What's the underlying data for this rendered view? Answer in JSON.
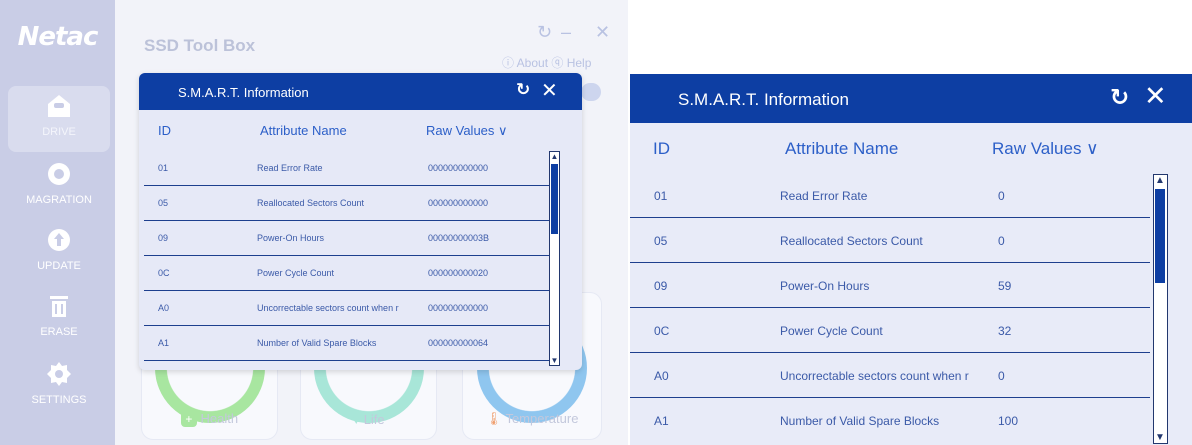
{
  "app": {
    "logo": "Netac",
    "title": "SSD Tool Box",
    "refresh_icon": "↻",
    "minimize_icon": "–",
    "close_icon": "✕",
    "about_help": "ⓘ About ⓠ Help"
  },
  "sidebar": {
    "items": [
      {
        "label": "DRIVE",
        "icon": "drive-icon",
        "active": true
      },
      {
        "label": "MAGRATION",
        "icon": "migration-icon",
        "active": false
      },
      {
        "label": "UPDATE",
        "icon": "update-icon",
        "active": false
      },
      {
        "label": "ERASE",
        "icon": "trash-icon",
        "active": false
      },
      {
        "label": "SETTINGS",
        "icon": "gear-icon",
        "active": false
      }
    ]
  },
  "cards": [
    {
      "label": "Health",
      "icon": "plus-icon"
    },
    {
      "label": "Life",
      "icon": "heart-icon"
    },
    {
      "label": "Temperature",
      "icon": "thermometer-icon"
    }
  ],
  "dialog_small": {
    "title": "S.M.A.R.T. Information",
    "refresh_icon": "↻",
    "close_icon": "✕",
    "columns": {
      "id": "ID",
      "name": "Attribute Name",
      "raw": "Raw Values ∨"
    },
    "rows": [
      {
        "id": "01",
        "name": "Read Error Rate",
        "raw": "000000000000"
      },
      {
        "id": "05",
        "name": "Reallocated Sectors Count",
        "raw": "000000000000"
      },
      {
        "id": "09",
        "name": "Power-On Hours",
        "raw": "00000000003B"
      },
      {
        "id": "0C",
        "name": "Power Cycle Count",
        "raw": "000000000020"
      },
      {
        "id": "A0",
        "name": "Uncorrectable sectors count when r",
        "raw": "000000000000"
      },
      {
        "id": "A1",
        "name": "Number of Valid Spare Blocks",
        "raw": "000000000064"
      }
    ]
  },
  "dialog_large": {
    "title": "S.M.A.R.T. Information",
    "refresh_icon": "↻",
    "close_icon": "✕",
    "columns": {
      "id": "ID",
      "name": "Attribute Name",
      "raw": "Raw Values ∨"
    },
    "rows": [
      {
        "id": "01",
        "name": "Read Error Rate",
        "raw": "0"
      },
      {
        "id": "05",
        "name": "Reallocated Sectors Count",
        "raw": "0"
      },
      {
        "id": "09",
        "name": "Power-On Hours",
        "raw": "59"
      },
      {
        "id": "0C",
        "name": "Power Cycle Count",
        "raw": "32"
      },
      {
        "id": "A0",
        "name": "Uncorrectable sectors count when r",
        "raw": "0"
      },
      {
        "id": "A1",
        "name": "Number of Valid Spare Blocks",
        "raw": "100"
      }
    ]
  },
  "scrollbar": {
    "up_icon": "▲",
    "down_icon": "▼"
  },
  "colors": {
    "header_blue": "#0d3ea3",
    "sidebar": "#c9cde6",
    "text_blue": "#3b5aa8",
    "gauge_green": "#a8e6a0",
    "gauge_blue": "#8fc6ef"
  }
}
